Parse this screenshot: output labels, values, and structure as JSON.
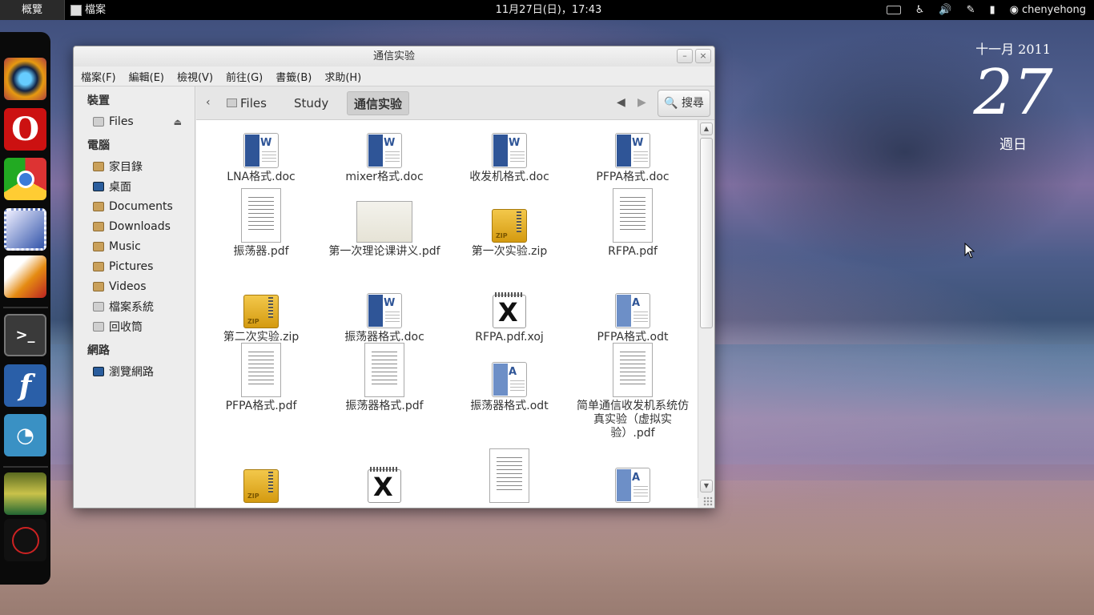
{
  "topbar": {
    "activities": "概覽",
    "app_menu": "檔案",
    "clock": "11月27日(日)，17:43",
    "user": "chenyehong",
    "icons": [
      "keyboard-icon",
      "accessibility-icon",
      "volume-icon",
      "pen-icon",
      "battery-icon",
      "user-status-icon"
    ]
  },
  "dock": {
    "apps": [
      "eye-of-gnome",
      "opera",
      "chrome",
      "evolution",
      "matlab",
      "terminal",
      "fedora",
      "pidgin",
      "photo-widget",
      "app-indicator"
    ]
  },
  "date_widget": {
    "month_year": "十一月 2011",
    "day": "27",
    "weekday": "週日"
  },
  "window": {
    "title": "通信实验",
    "minimize": "–",
    "close": "×",
    "menu": [
      "檔案(F)",
      "編輯(E)",
      "檢視(V)",
      "前往(G)",
      "書籤(B)",
      "求助(H)"
    ],
    "sidebar": {
      "devices_heading": "裝置",
      "devices": [
        {
          "label": "Files",
          "icon": "drive-icon"
        }
      ],
      "computer_heading": "電腦",
      "places": [
        {
          "label": "家目錄",
          "icon": "home-folder-icon"
        },
        {
          "label": "桌面",
          "icon": "desktop-icon"
        },
        {
          "label": "Documents",
          "icon": "folder-icon"
        },
        {
          "label": "Downloads",
          "icon": "folder-icon"
        },
        {
          "label": "Music",
          "icon": "music-folder-icon"
        },
        {
          "label": "Pictures",
          "icon": "pictures-folder-icon"
        },
        {
          "label": "Videos",
          "icon": "videos-folder-icon"
        },
        {
          "label": "檔案系統",
          "icon": "filesystem-icon"
        },
        {
          "label": "回收筒",
          "icon": "trash-icon"
        }
      ],
      "network_heading": "網路",
      "network": [
        {
          "label": "瀏覽網路",
          "icon": "network-icon"
        }
      ]
    },
    "path_bar": {
      "back": "‹",
      "crumbs": [
        "Files",
        "Study",
        "通信实验"
      ],
      "search": "搜尋"
    },
    "files": [
      {
        "name": "LNA格式.doc",
        "type": "doc"
      },
      {
        "name": "mixer格式.doc",
        "type": "doc"
      },
      {
        "name": "收发机格式.doc",
        "type": "doc"
      },
      {
        "name": "PFPA格式.doc",
        "type": "doc"
      },
      {
        "name": "振荡器.pdf",
        "type": "pdf"
      },
      {
        "name": "第一次理论课讲义.pdf",
        "type": "slide"
      },
      {
        "name": "第一次实验.zip",
        "type": "zip"
      },
      {
        "name": "RFPA.pdf",
        "type": "pdf"
      },
      {
        "name": "第二次实验.zip",
        "type": "zip"
      },
      {
        "name": "振荡器格式.doc",
        "type": "doc"
      },
      {
        "name": "RFPA.pdf.xoj",
        "type": "xoj"
      },
      {
        "name": "PFPA格式.odt",
        "type": "odt"
      },
      {
        "name": "PFPA格式.pdf",
        "type": "pdf"
      },
      {
        "name": "振荡器格式.pdf",
        "type": "pdf"
      },
      {
        "name": "振荡器格式.odt",
        "type": "odt"
      },
      {
        "name": "简单通信收发机系统仿真实验（虚拟实验）.pdf",
        "type": "pdf"
      },
      {
        "name": "",
        "type": "zip"
      },
      {
        "name": "",
        "type": "xoj"
      },
      {
        "name": "",
        "type": "pdf"
      },
      {
        "name": "",
        "type": "odt"
      }
    ]
  }
}
